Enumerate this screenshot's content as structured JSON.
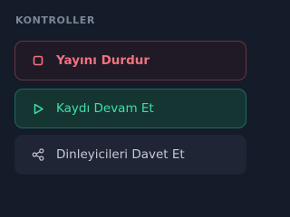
{
  "controls": {
    "section_title": "KONTROLLER",
    "buttons": [
      {
        "label": "Yayını Durdur",
        "icon": "stop-square-icon",
        "color": "#f07280"
      },
      {
        "label": "Kaydı Devam Et",
        "icon": "play-icon",
        "color": "#3ee0a8"
      },
      {
        "label": "Dinleyicileri Davet Et",
        "icon": "share-icon",
        "color": "#c4c9d3"
      }
    ]
  }
}
